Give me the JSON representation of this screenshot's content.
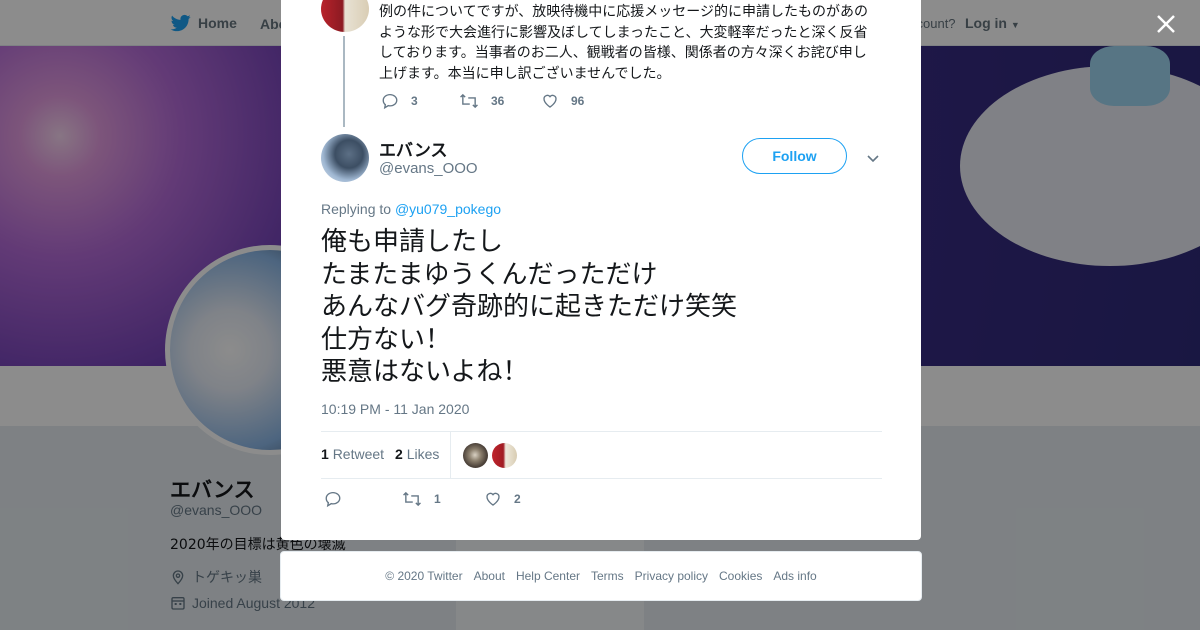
{
  "nav": {
    "home_label": "Home",
    "about_label": "Abo",
    "account_text": "ccount?",
    "login_label": "Log in"
  },
  "profile": {
    "name": "エバンス",
    "handle": "@evans_OOO",
    "bio": "2020年の目標は黄色の壊滅",
    "location": "トゲキッ巣",
    "joined": "Joined August 2012"
  },
  "parent_tweet": {
    "text": "例の件についてですが、放映待機中に応援メッセージ的に申請したものがあのような形で大会進行に影響及ぼしてしまったこと、大変軽率だったと深く反省しております。当事者のお二人、観戦者の皆様、関係者の方々深くお詫び申し上げます。本当に申し訳ございませんでした。",
    "reply_count": "3",
    "retweet_count": "36",
    "like_count": "96"
  },
  "tweet": {
    "author_name": "エバンス",
    "author_handle": "@evans_OOO",
    "follow_label": "Follow",
    "replying_prefix": "Replying to",
    "replying_to": "@yu079_pokego",
    "lines": [
      "俺も申請したし",
      "たまたまゆうくんだっただけ",
      "あんなバグ奇跡的に起きただけ笑笑",
      "仕方ない！",
      "悪意はないよね！"
    ],
    "timestamp": "10:19 PM - 11 Jan 2020",
    "retweets_count": "1",
    "retweets_label": "Retweet",
    "likes_count": "2",
    "likes_label": "Likes",
    "action_retweet_count": "1",
    "action_like_count": "2"
  },
  "footer": {
    "items": [
      "© 2020 Twitter",
      "About",
      "Help Center",
      "Terms",
      "Privacy policy",
      "Cookies",
      "Ads info"
    ]
  },
  "colors": {
    "accent": "#1da1f2",
    "text": "#14171a",
    "muted": "#657786",
    "border": "#e6ecf0"
  }
}
